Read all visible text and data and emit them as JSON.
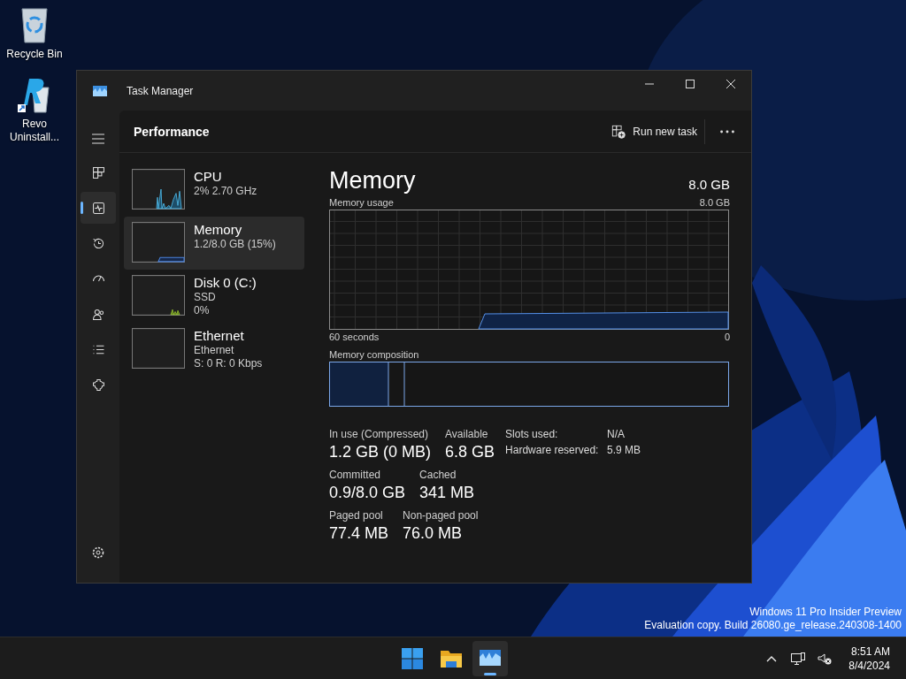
{
  "desktop_icons": [
    {
      "kind": "recycle",
      "label": "Recycle Bin"
    },
    {
      "kind": "revo",
      "label": "Revo Uninstall..."
    }
  ],
  "window": {
    "title": "Task Manager"
  },
  "nav": [
    {
      "kind": "processes",
      "selected": false
    },
    {
      "kind": "performance",
      "selected": true
    },
    {
      "kind": "history",
      "selected": false
    },
    {
      "kind": "startup",
      "selected": false
    },
    {
      "kind": "users",
      "selected": false
    },
    {
      "kind": "details",
      "selected": false
    },
    {
      "kind": "services",
      "selected": false
    }
  ],
  "header": {
    "title": "Performance",
    "run_task": "Run new task"
  },
  "devices": [
    {
      "kind": "cpu",
      "name": "CPU",
      "lines": [
        "2% 2.70 GHz"
      ],
      "selected": false
    },
    {
      "kind": "memory",
      "name": "Memory",
      "lines": [
        "1.2/8.0 GB (15%)"
      ],
      "selected": true
    },
    {
      "kind": "disk",
      "name": "Disk 0 (C:)",
      "lines": [
        "SSD",
        "0%"
      ],
      "selected": false
    },
    {
      "kind": "ethernet",
      "name": "Ethernet",
      "lines": [
        "Ethernet",
        "S: 0 R: 0 Kbps"
      ],
      "selected": false
    }
  ],
  "detail": {
    "title": "Memory",
    "capacity": "8.0 GB",
    "usage_label": "Memory usage",
    "usage_max": "8.0 GB",
    "x_start": "60 seconds",
    "x_end": "0",
    "composition_label": "Memory composition",
    "stats": [
      [
        {
          "label": "In use (Compressed)",
          "value": "1.2 GB (0 MB)"
        },
        {
          "label": "Available",
          "value": "6.8 GB"
        }
      ],
      [
        {
          "label": "Committed",
          "value": "0.9/8.0 GB"
        },
        {
          "label": "Cached",
          "value": "341 MB"
        }
      ],
      [
        {
          "label": "Paged pool",
          "value": "77.4 MB"
        },
        {
          "label": "Non-paged pool",
          "value": "76.0 MB"
        }
      ]
    ],
    "side_stats": [
      {
        "label": "Slots used:",
        "value": "N/A"
      },
      {
        "label": "Hardware reserved:",
        "value": "5.9 MB"
      }
    ]
  },
  "watermark": [
    "Windows 11 Pro Insider Preview",
    "Evaluation copy. Build 26080.ge_release.240308-1400"
  ],
  "taskbar": {
    "apps": [
      {
        "kind": "start",
        "selected": false
      },
      {
        "kind": "explorer",
        "selected": false
      },
      {
        "kind": "taskmgr",
        "selected": true
      }
    ],
    "time": "8:51 AM",
    "date": "8/4/2024"
  }
}
